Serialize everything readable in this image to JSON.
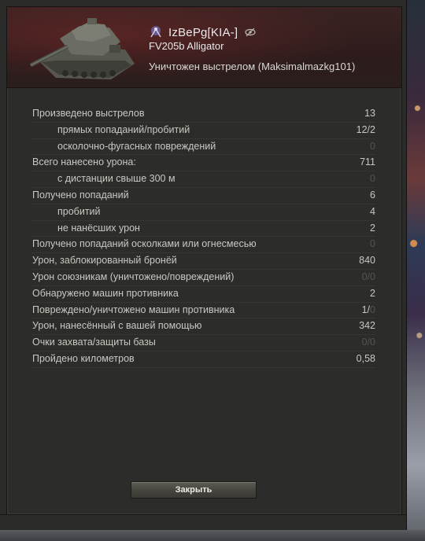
{
  "header": {
    "player_name": "IzBePg[KIA-]",
    "vehicle_name": "FV205b Alligator",
    "death_status": "Уничтожен выстрелом (Maksimalmazkg101)",
    "icons": [
      "clan-emblem-icon",
      "hidden-eye-icon",
      "tank-image"
    ]
  },
  "stats": [
    {
      "label": "Произведено выстрелов",
      "sub": false,
      "value": "13"
    },
    {
      "label": "прямых попаданий/пробитий",
      "sub": true,
      "value": "12/2"
    },
    {
      "label": "осколочно-фугасных повреждений",
      "sub": true,
      "value": "0",
      "dim": true
    },
    {
      "label": "Всего нанесено урона:",
      "sub": false,
      "value": "711"
    },
    {
      "label": "с дистанции свыше 300 м",
      "sub": true,
      "value": "0",
      "dim": true
    },
    {
      "label": "Получено попаданий",
      "sub": false,
      "value": "6"
    },
    {
      "label": "пробитий",
      "sub": true,
      "value": "4"
    },
    {
      "label": "не нанёсших урон",
      "sub": true,
      "value": "2"
    },
    {
      "label": "Получено попаданий осколками или огнесмесью",
      "sub": false,
      "value": "0",
      "dim": true
    },
    {
      "label": "Урон, заблокированный бронёй",
      "sub": false,
      "value": "840"
    },
    {
      "label": "Урон союзникам (уничтожено/повреждений)",
      "sub": false,
      "value": "0/0",
      "dim": true
    },
    {
      "label": "Обнаружено машин противника",
      "sub": false,
      "value": "2"
    },
    {
      "label": "Повреждено/уничтожено машин противника",
      "sub": false,
      "value_main": "1/",
      "value_dim": "0"
    },
    {
      "label": "Урон, нанесённый с вашей помощью",
      "sub": false,
      "value": "342"
    },
    {
      "label": "Очки захвата/защиты базы",
      "sub": false,
      "value": "0/0",
      "dim": true
    },
    {
      "label": "Пройдено километров",
      "sub": false,
      "value": "0,58"
    }
  ],
  "close_button": {
    "label": "Закрыть"
  }
}
